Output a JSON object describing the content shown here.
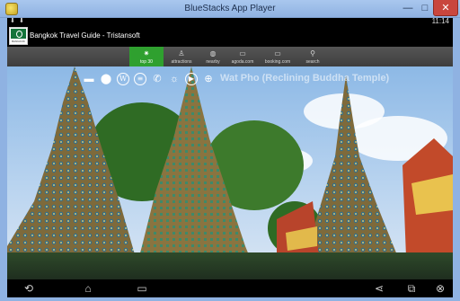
{
  "window": {
    "title": "BlueStacks App Player",
    "minimize_symbol": "—",
    "maximize_symbol": "□",
    "close_symbol": "✕"
  },
  "status_bar": {
    "time": "11:14",
    "icons": [
      "download-icon",
      "download-icon"
    ]
  },
  "app": {
    "logo_text": "BANGKOK",
    "title": "Bangkok Travel Guide - Tristansoft"
  },
  "tabs": [
    {
      "label": "top 30",
      "icon": "star-icon",
      "active": true
    },
    {
      "label": "attractions",
      "icon": "person-icon",
      "active": false
    },
    {
      "label": "nearby",
      "icon": "compass-icon",
      "active": false
    },
    {
      "label": "agoda.com",
      "icon": "bed-icon",
      "active": false
    },
    {
      "label": "booking.com",
      "icon": "bed-icon",
      "active": false
    },
    {
      "label": "search",
      "icon": "search-icon",
      "active": false
    }
  ],
  "place": {
    "title": "Wat Pho (Reclining Buddha Temple)",
    "action_icons": [
      "hotel-icon",
      "location-pin-icon",
      "wikipedia-icon",
      "web-icon",
      "phone-icon",
      "weather-icon",
      "play-icon",
      "globe-icon"
    ]
  },
  "navigation": {
    "back": "back-icon",
    "home": "home-icon",
    "recents": "recents-icon",
    "share": "share-icon",
    "window": "window-icon",
    "close": "close-icon"
  }
}
